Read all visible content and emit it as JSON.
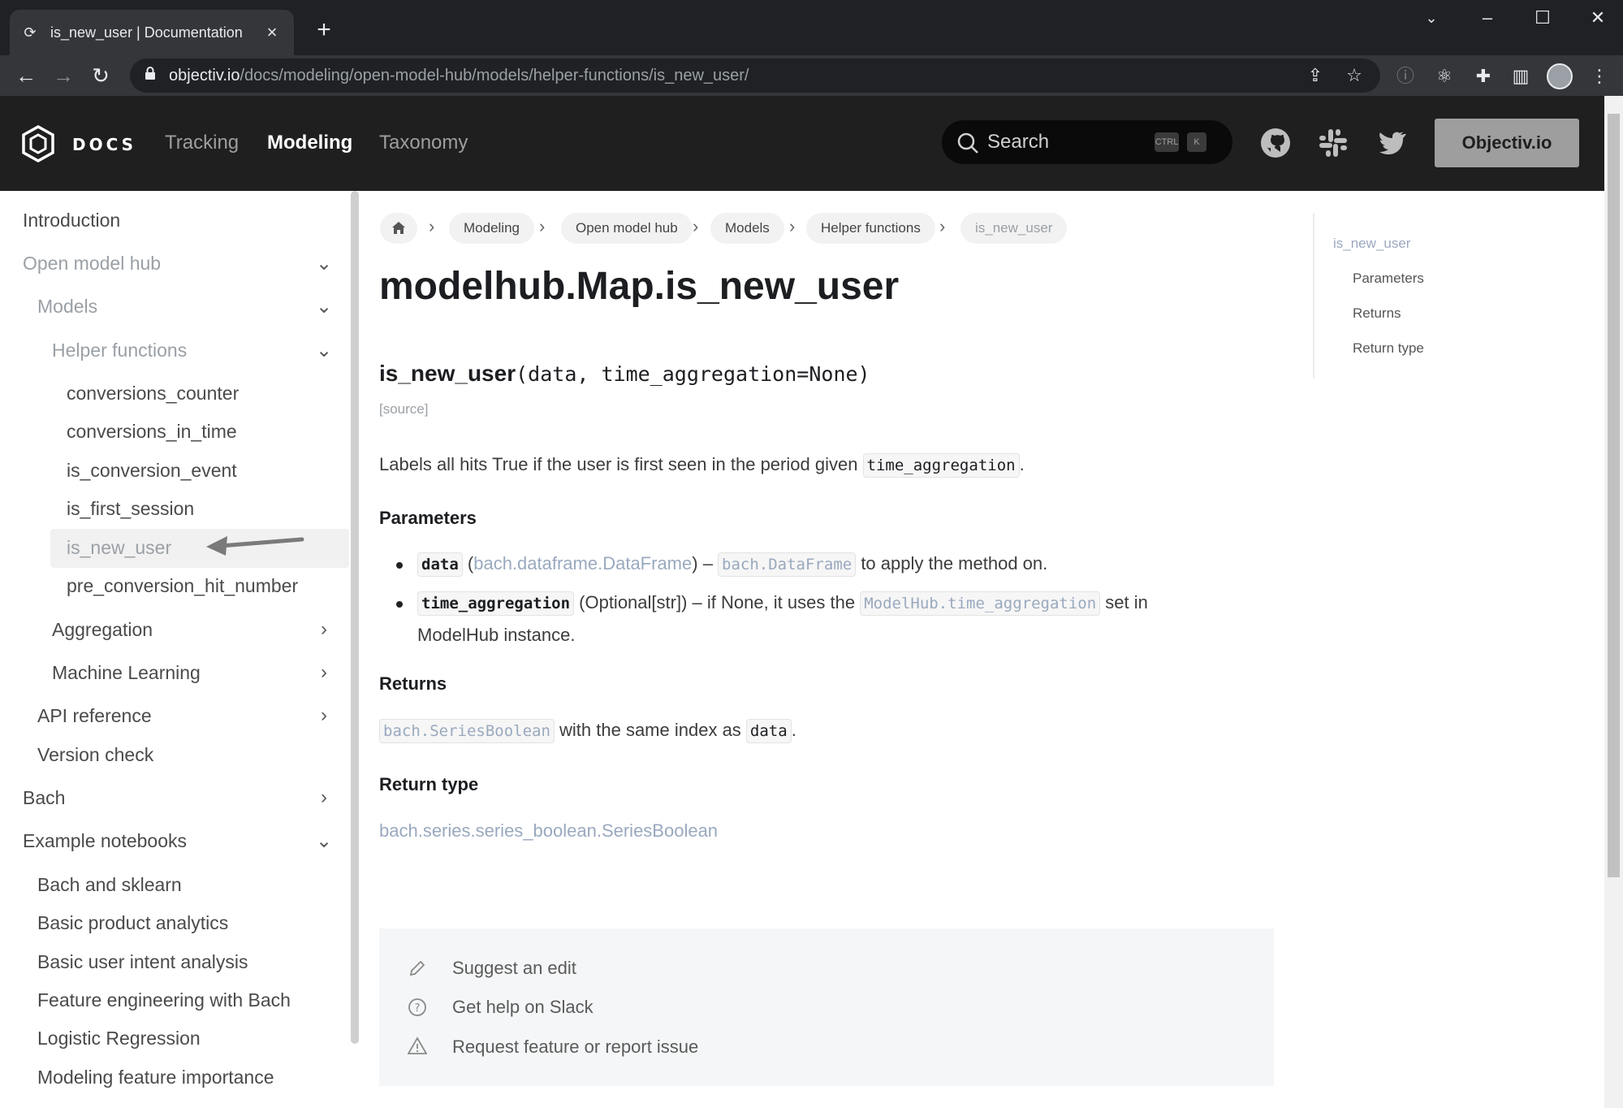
{
  "browser": {
    "tab_title": "is_new_user | Documentation",
    "url_host": "objectiv.io",
    "url_path": "/docs/modeling/open-model-hub/models/helper-functions/is_new_user/"
  },
  "header": {
    "logo_text": "DOCS",
    "nav": [
      "Tracking",
      "Modeling",
      "Taxonomy"
    ],
    "active_nav": "Modeling",
    "search_placeholder": "Search",
    "search_kbd": [
      "CTRL",
      "K"
    ],
    "cta_label": "Objectiv.io"
  },
  "sidebar": {
    "items": [
      {
        "label": "Introduction"
      },
      {
        "label": "Open model hub",
        "arrow": "down"
      },
      {
        "label": "Models",
        "arrow": "down"
      },
      {
        "label": "Helper functions",
        "arrow": "down"
      },
      {
        "label": "conversions_counter"
      },
      {
        "label": "conversions_in_time"
      },
      {
        "label": "is_conversion_event"
      },
      {
        "label": "is_first_session"
      },
      {
        "label": "is_new_user",
        "active": true
      },
      {
        "label": "pre_conversion_hit_number"
      },
      {
        "label": "Aggregation",
        "arrow": "right"
      },
      {
        "label": "Machine Learning",
        "arrow": "right"
      },
      {
        "label": "API reference",
        "arrow": "right"
      },
      {
        "label": "Version check"
      },
      {
        "label": "Bach",
        "arrow": "right"
      },
      {
        "label": "Example notebooks",
        "arrow": "down"
      },
      {
        "label": "Bach and sklearn"
      },
      {
        "label": "Basic product analytics"
      },
      {
        "label": "Basic user intent analysis"
      },
      {
        "label": "Feature engineering with Bach"
      },
      {
        "label": "Logistic Regression"
      },
      {
        "label": "Modeling feature importance"
      }
    ]
  },
  "breadcrumbs": [
    "Modeling",
    "Open model hub",
    "Models",
    "Helper functions",
    "is_new_user"
  ],
  "content": {
    "title": "modelhub.Map.is_new_user",
    "signature_name": "is_new_user",
    "signature_args": "(data, time_aggregation=None)",
    "source_link": "[source]",
    "description_pre": "Labels all hits True if the user is first seen in the period given ",
    "description_code": "time_aggregation",
    "description_post": ".",
    "parameters_heading": "Parameters",
    "param1_name": "data",
    "param1_type_open": " (",
    "param1_type": "bach.dataframe.DataFrame",
    "param1_dash": ") – ",
    "param1_code": "bach.DataFrame",
    "param1_desc": " to apply the method on.",
    "param2_name": "time_aggregation",
    "param2_text": " (Optional[str]) – if None, it uses the ",
    "param2_code": "ModelHub.time_aggregation",
    "param2_post": " set in",
    "param2_line2": "ModelHub instance.",
    "returns_heading": "Returns",
    "returns_code": "bach.SeriesBoolean",
    "returns_text": " with the same index as ",
    "returns_code2": "data",
    "returns_post": ".",
    "return_type_heading": "Return type",
    "return_type_link": "bach.series.series_boolean.SeriesBoolean"
  },
  "footer": {
    "suggest_edit": "Suggest an edit",
    "get_help": "Get help on Slack",
    "request_feature": "Request feature or report issue"
  },
  "toc": {
    "items": [
      "is_new_user",
      "Parameters",
      "Returns",
      "Return type"
    ]
  }
}
